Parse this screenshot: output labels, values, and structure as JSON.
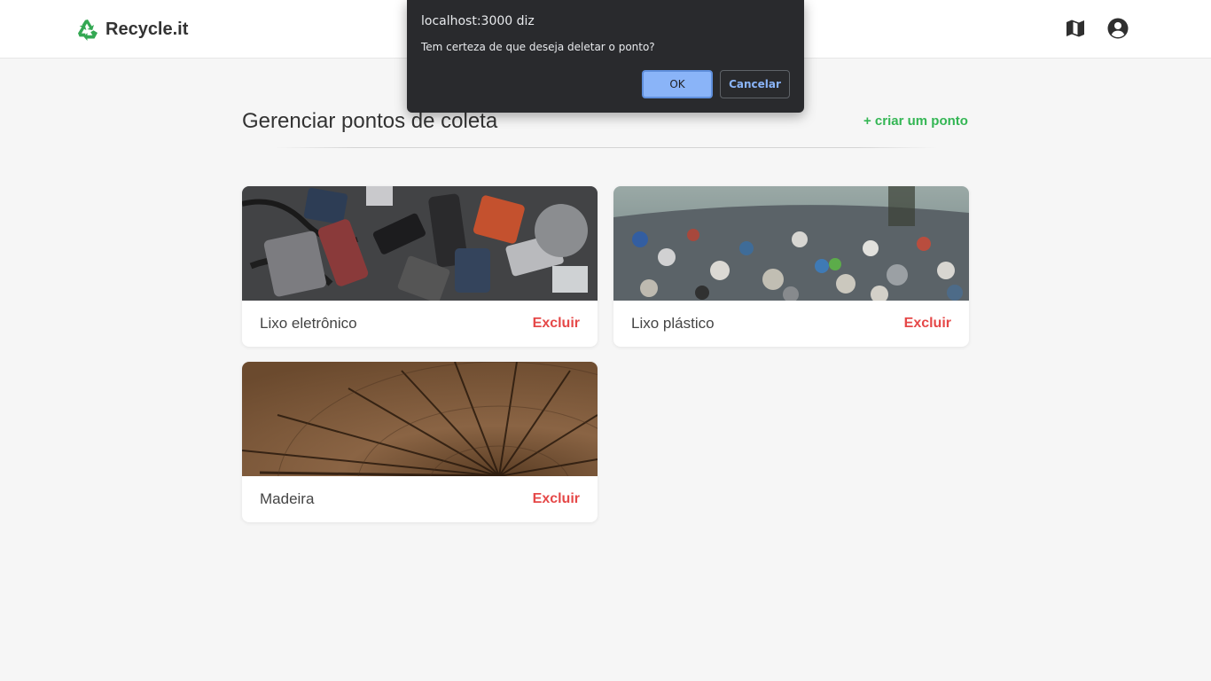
{
  "header": {
    "brand": "Recycle.it",
    "brand_color": "#34a853",
    "icons": [
      "recycle-icon",
      "map-icon",
      "user-circle-icon"
    ]
  },
  "main": {
    "title": "Gerenciar pontos de coleta",
    "create_link": "+ criar um ponto",
    "accent_color": "#34b654",
    "delete_color": "#e54848",
    "cards": [
      {
        "title": "Lixo eletrônico",
        "action": "Excluir",
        "image": "electronic-waste-photo"
      },
      {
        "title": "Lixo plástico",
        "action": "Excluir",
        "image": "plastic-waste-landfill-photo"
      },
      {
        "title": "Madeira",
        "action": "Excluir",
        "image": "wood-cross-section-photo"
      }
    ]
  },
  "dialog": {
    "origin": "localhost:3000 diz",
    "message": "Tem certeza de que deseja deletar o ponto?",
    "ok_label": "OK",
    "cancel_label": "Cancelar"
  }
}
